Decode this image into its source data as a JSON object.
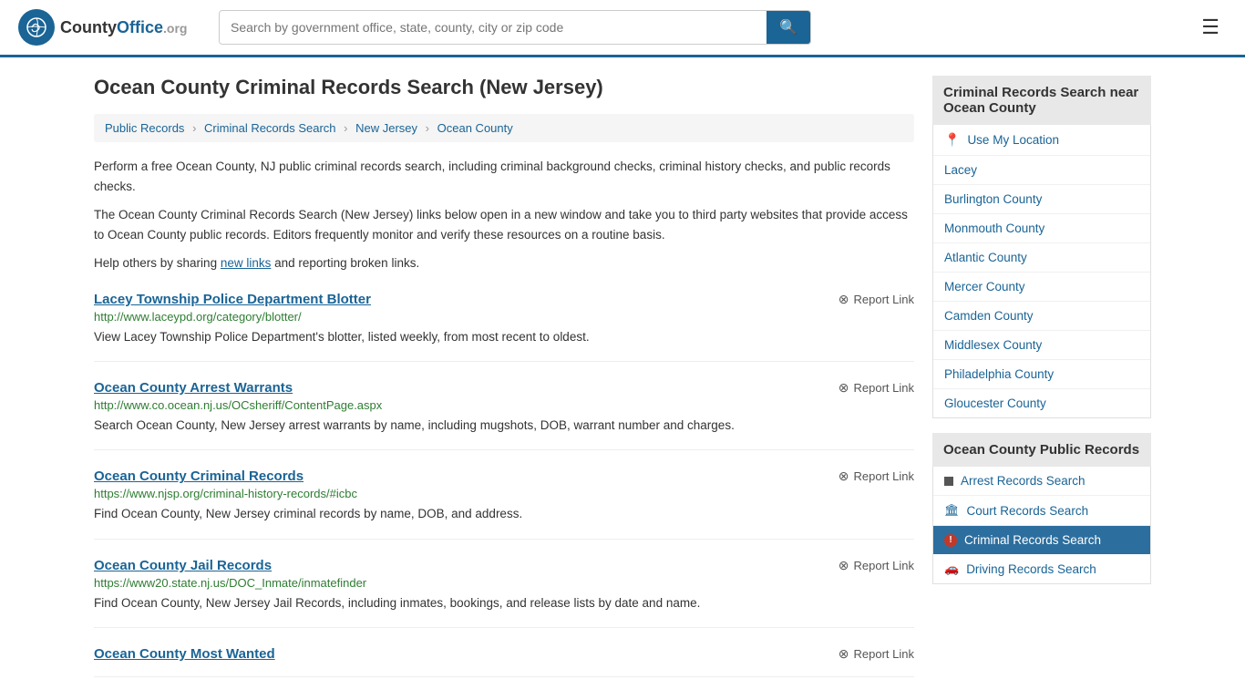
{
  "header": {
    "logo_text": "County",
    "logo_org": "Office",
    "logo_domain": ".org",
    "search_placeholder": "Search by government office, state, county, city or zip code",
    "search_icon": "🔍"
  },
  "page": {
    "title": "Ocean County Criminal Records Search (New Jersey)",
    "breadcrumbs": [
      {
        "label": "Public Records",
        "href": "#"
      },
      {
        "label": "Criminal Records Search",
        "href": "#"
      },
      {
        "label": "New Jersey",
        "href": "#"
      },
      {
        "label": "Ocean County",
        "href": "#"
      }
    ],
    "description1": "Perform a free Ocean County, NJ public criminal records search, including criminal background checks, criminal history checks, and public records checks.",
    "description2": "The Ocean County Criminal Records Search (New Jersey) links below open in a new window and take you to third party websites that provide access to Ocean County public records. Editors frequently monitor and verify these resources on a routine basis.",
    "description3_pre": "Help others by sharing ",
    "description3_link": "new links",
    "description3_post": " and reporting broken links."
  },
  "results": [
    {
      "title": "Lacey Township Police Department Blotter",
      "url": "http://www.laceypd.org/category/blotter/",
      "desc": "View Lacey Township Police Department's blotter, listed weekly, from most recent to oldest."
    },
    {
      "title": "Ocean County Arrest Warrants",
      "url": "http://www.co.ocean.nj.us/OCsheriff/ContentPage.aspx",
      "desc": "Search Ocean County, New Jersey arrest warrants by name, including mugshots, DOB, warrant number and charges."
    },
    {
      "title": "Ocean County Criminal Records",
      "url": "https://www.njsp.org/criminal-history-records/#icbc",
      "desc": "Find Ocean County, New Jersey criminal records by name, DOB, and address."
    },
    {
      "title": "Ocean County Jail Records",
      "url": "https://www20.state.nj.us/DOC_Inmate/inmatefinder",
      "desc": "Find Ocean County, New Jersey Jail Records, including inmates, bookings, and release lists by date and name."
    },
    {
      "title": "Ocean County Most Wanted",
      "url": "",
      "desc": ""
    }
  ],
  "report_label": "Report Link",
  "sidebar": {
    "nearby_title": "Criminal Records Search near Ocean County",
    "nearby_items": [
      {
        "label": "Use My Location",
        "icon": "location"
      },
      {
        "label": "Lacey",
        "icon": "none"
      },
      {
        "label": "Burlington County",
        "icon": "none"
      },
      {
        "label": "Monmouth County",
        "icon": "none"
      },
      {
        "label": "Atlantic County",
        "icon": "none"
      },
      {
        "label": "Mercer County",
        "icon": "none"
      },
      {
        "label": "Camden County",
        "icon": "none"
      },
      {
        "label": "Middlesex County",
        "icon": "none"
      },
      {
        "label": "Philadelphia County",
        "icon": "none"
      },
      {
        "label": "Gloucester County",
        "icon": "none"
      }
    ],
    "public_records_title": "Ocean County Public Records",
    "public_records_items": [
      {
        "label": "Arrest Records Search",
        "icon": "square",
        "active": false
      },
      {
        "label": "Court Records Search",
        "icon": "courthouse",
        "active": false
      },
      {
        "label": "Criminal Records Search",
        "icon": "exclamation",
        "active": true
      },
      {
        "label": "Driving Records Search",
        "icon": "car",
        "active": false
      }
    ]
  }
}
